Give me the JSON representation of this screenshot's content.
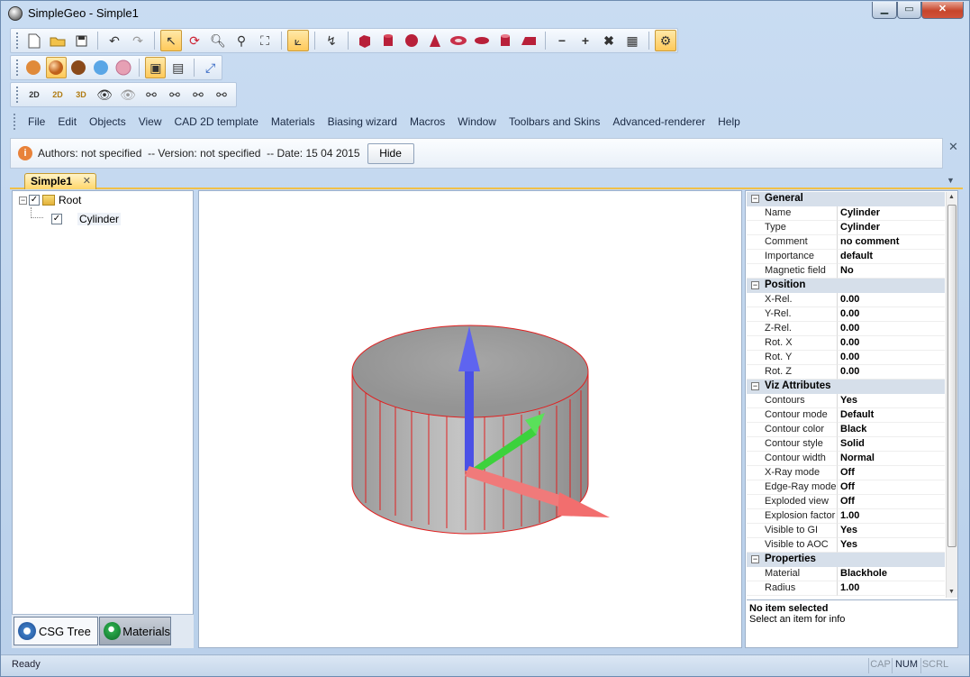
{
  "window": {
    "title": "SimpleGeo - Simple1"
  },
  "toolbar1": {
    "icons": [
      "new-file-icon",
      "open-icon",
      "save-icon",
      "undo-icon",
      "redo-icon",
      "select-icon",
      "rotate-icon",
      "zoom-in-icon",
      "zoom-out-icon",
      "fit-view-icon",
      "measure-icon",
      "pick-icon",
      "box-icon",
      "cylinder-icon",
      "sphere-icon",
      "cone-icon",
      "torus-icon",
      "ellipsoid-icon",
      "tube-icon",
      "wedge-icon",
      "minus-icon",
      "plus-icon",
      "intersect-icon",
      "grid-icon",
      "settings-icon"
    ]
  },
  "toolbar2": {
    "icons": [
      "solid-shading-icon",
      "smooth-shading-icon",
      "textured-shading-icon",
      "xray-shading-icon",
      "wire-shading-icon",
      "viz-mode-icon",
      "viz-mode-2-icon",
      "axes-icon"
    ]
  },
  "toolbar3": {
    "icons": [
      "2d-cut-icon",
      "2d-ruler-icon",
      "3d-cut-icon",
      "show-icon",
      "hide-icon",
      "find-icon",
      "find-next-icon",
      "find-prev-icon",
      "find-all-icon"
    ]
  },
  "menu": [
    "File",
    "Edit",
    "Objects",
    "View",
    "CAD 2D template",
    "Materials",
    "Biasing wizard",
    "Macros",
    "Window",
    "Toolbars and Skins",
    "Advanced-renderer",
    "Help"
  ],
  "infobar": {
    "text": "Authors: not specified  -- Version: not specified  -- Date: 15 04 2015",
    "hide_label": "Hide"
  },
  "tabs": {
    "doc_tab": "Simple1"
  },
  "tree": {
    "root": "Root",
    "child": "Cylinder"
  },
  "left_tabs": {
    "csg": "CSG Tree",
    "materials": "Materials"
  },
  "properties": {
    "general": {
      "label": "General",
      "rows": [
        [
          "Name",
          "Cylinder"
        ],
        [
          "Type",
          "Cylinder"
        ],
        [
          "Comment",
          "no comment"
        ],
        [
          "Importance",
          "default"
        ],
        [
          "Magnetic field",
          "No"
        ]
      ]
    },
    "position": {
      "label": "Position",
      "rows": [
        [
          "X-Rel.",
          "0.00"
        ],
        [
          "Y-Rel.",
          "0.00"
        ],
        [
          "Z-Rel.",
          "0.00"
        ],
        [
          "Rot. X",
          "0.00"
        ],
        [
          "Rot. Y",
          "0.00"
        ],
        [
          "Rot. Z",
          "0.00"
        ]
      ]
    },
    "viz": {
      "label": "Viz Attributes",
      "rows": [
        [
          "Contours",
          "Yes"
        ],
        [
          "Contour mode",
          "Default"
        ],
        [
          "Contour color",
          "Black"
        ],
        [
          "Contour style",
          "Solid"
        ],
        [
          "Contour width",
          "Normal"
        ],
        [
          "X-Ray mode",
          "Off"
        ],
        [
          "Edge-Ray mode",
          "Off"
        ],
        [
          "Exploded view",
          "Off"
        ],
        [
          "Explosion factor",
          "1.00"
        ],
        [
          "Visible to GI",
          "Yes"
        ],
        [
          "Visible to AOC",
          "Yes"
        ]
      ]
    },
    "props": {
      "label": "Properties",
      "rows": [
        [
          "Material",
          "Blackhole"
        ],
        [
          "Radius",
          "1.00"
        ]
      ]
    }
  },
  "description": {
    "title": "No item selected",
    "text": "Select an item for info"
  },
  "statusbar": {
    "text": "Ready",
    "cap": "CAP",
    "num": "NUM",
    "scrl": "SCRL"
  },
  "colors": {
    "accent": "#ffc95a",
    "cylinder": "#a8a8a8",
    "edge": "#e02020",
    "axis_x": "#f06a6a",
    "axis_y": "#3cd23c",
    "axis_z": "#4a50e6"
  }
}
